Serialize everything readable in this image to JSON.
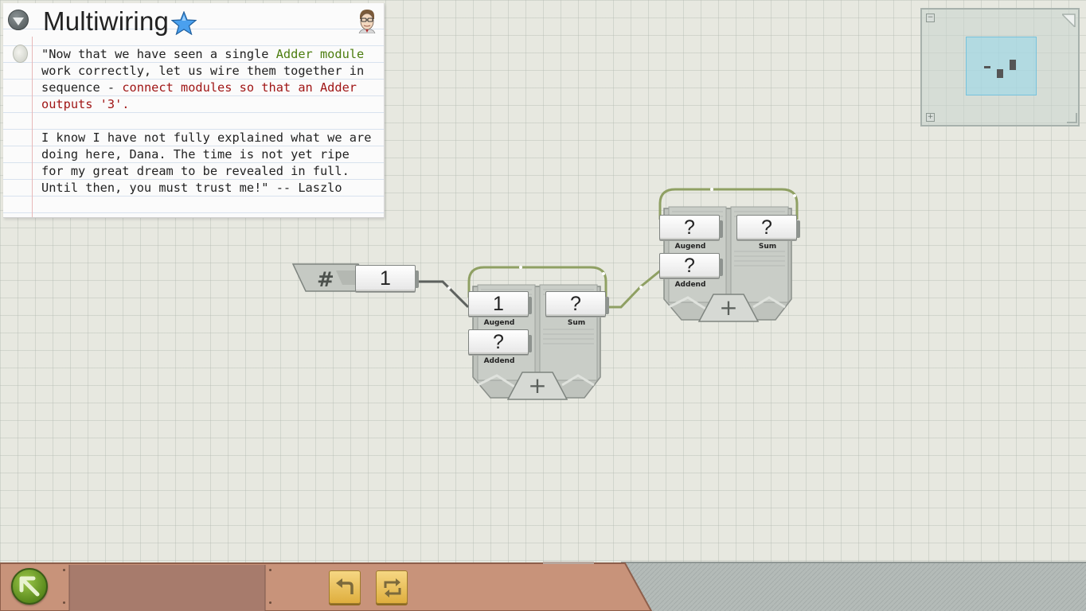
{
  "panel": {
    "title": "Multiwiring",
    "text": {
      "p1_a": "\"Now that we have seen a single ",
      "p1_b": "Adder module",
      "p1_c": " work correctly, let us wire them together in sequence - ",
      "p1_d": "connect modules so that an Adder outputs '3'.",
      "p2": "I know I have not fully explained what we are doing here, Dana. The time is not yet ripe for my great dream to be revealed in full. Until then, you must trust me!\" -- Laszlo"
    },
    "icons": {
      "collapse": "triangle-down-icon",
      "star": "star-icon",
      "portrait": "laszlo-portrait-icon",
      "bullet": "bullet-icon"
    }
  },
  "minimap": {
    "zoom_out": "−",
    "zoom_in": "+"
  },
  "number_module": {
    "symbol": "#",
    "value": "1"
  },
  "adder1": {
    "augend_value": "1",
    "augend_label": "Augend",
    "addend_value": "?",
    "addend_label": "Addend",
    "sum_value": "?",
    "sum_label": "Sum",
    "operator": "+"
  },
  "adder2": {
    "augend_value": "?",
    "augend_label": "Augend",
    "addend_value": "?",
    "addend_label": "Addend",
    "sum_value": "?",
    "sum_label": "Sum",
    "operator": "+"
  },
  "toolbar": {
    "icons": {
      "back": "back-arrow-icon",
      "undo": "undo-icon",
      "reset": "reset-icon"
    }
  },
  "colors": {
    "background": "#e7e8e0",
    "wire_green": "#8fa063",
    "wire_dark": "#5a5e5b",
    "toolbar_copper": "#c8937a",
    "accent_star": "#3d8fe0",
    "text_green": "#4c7d0f",
    "text_red": "#a01616"
  }
}
